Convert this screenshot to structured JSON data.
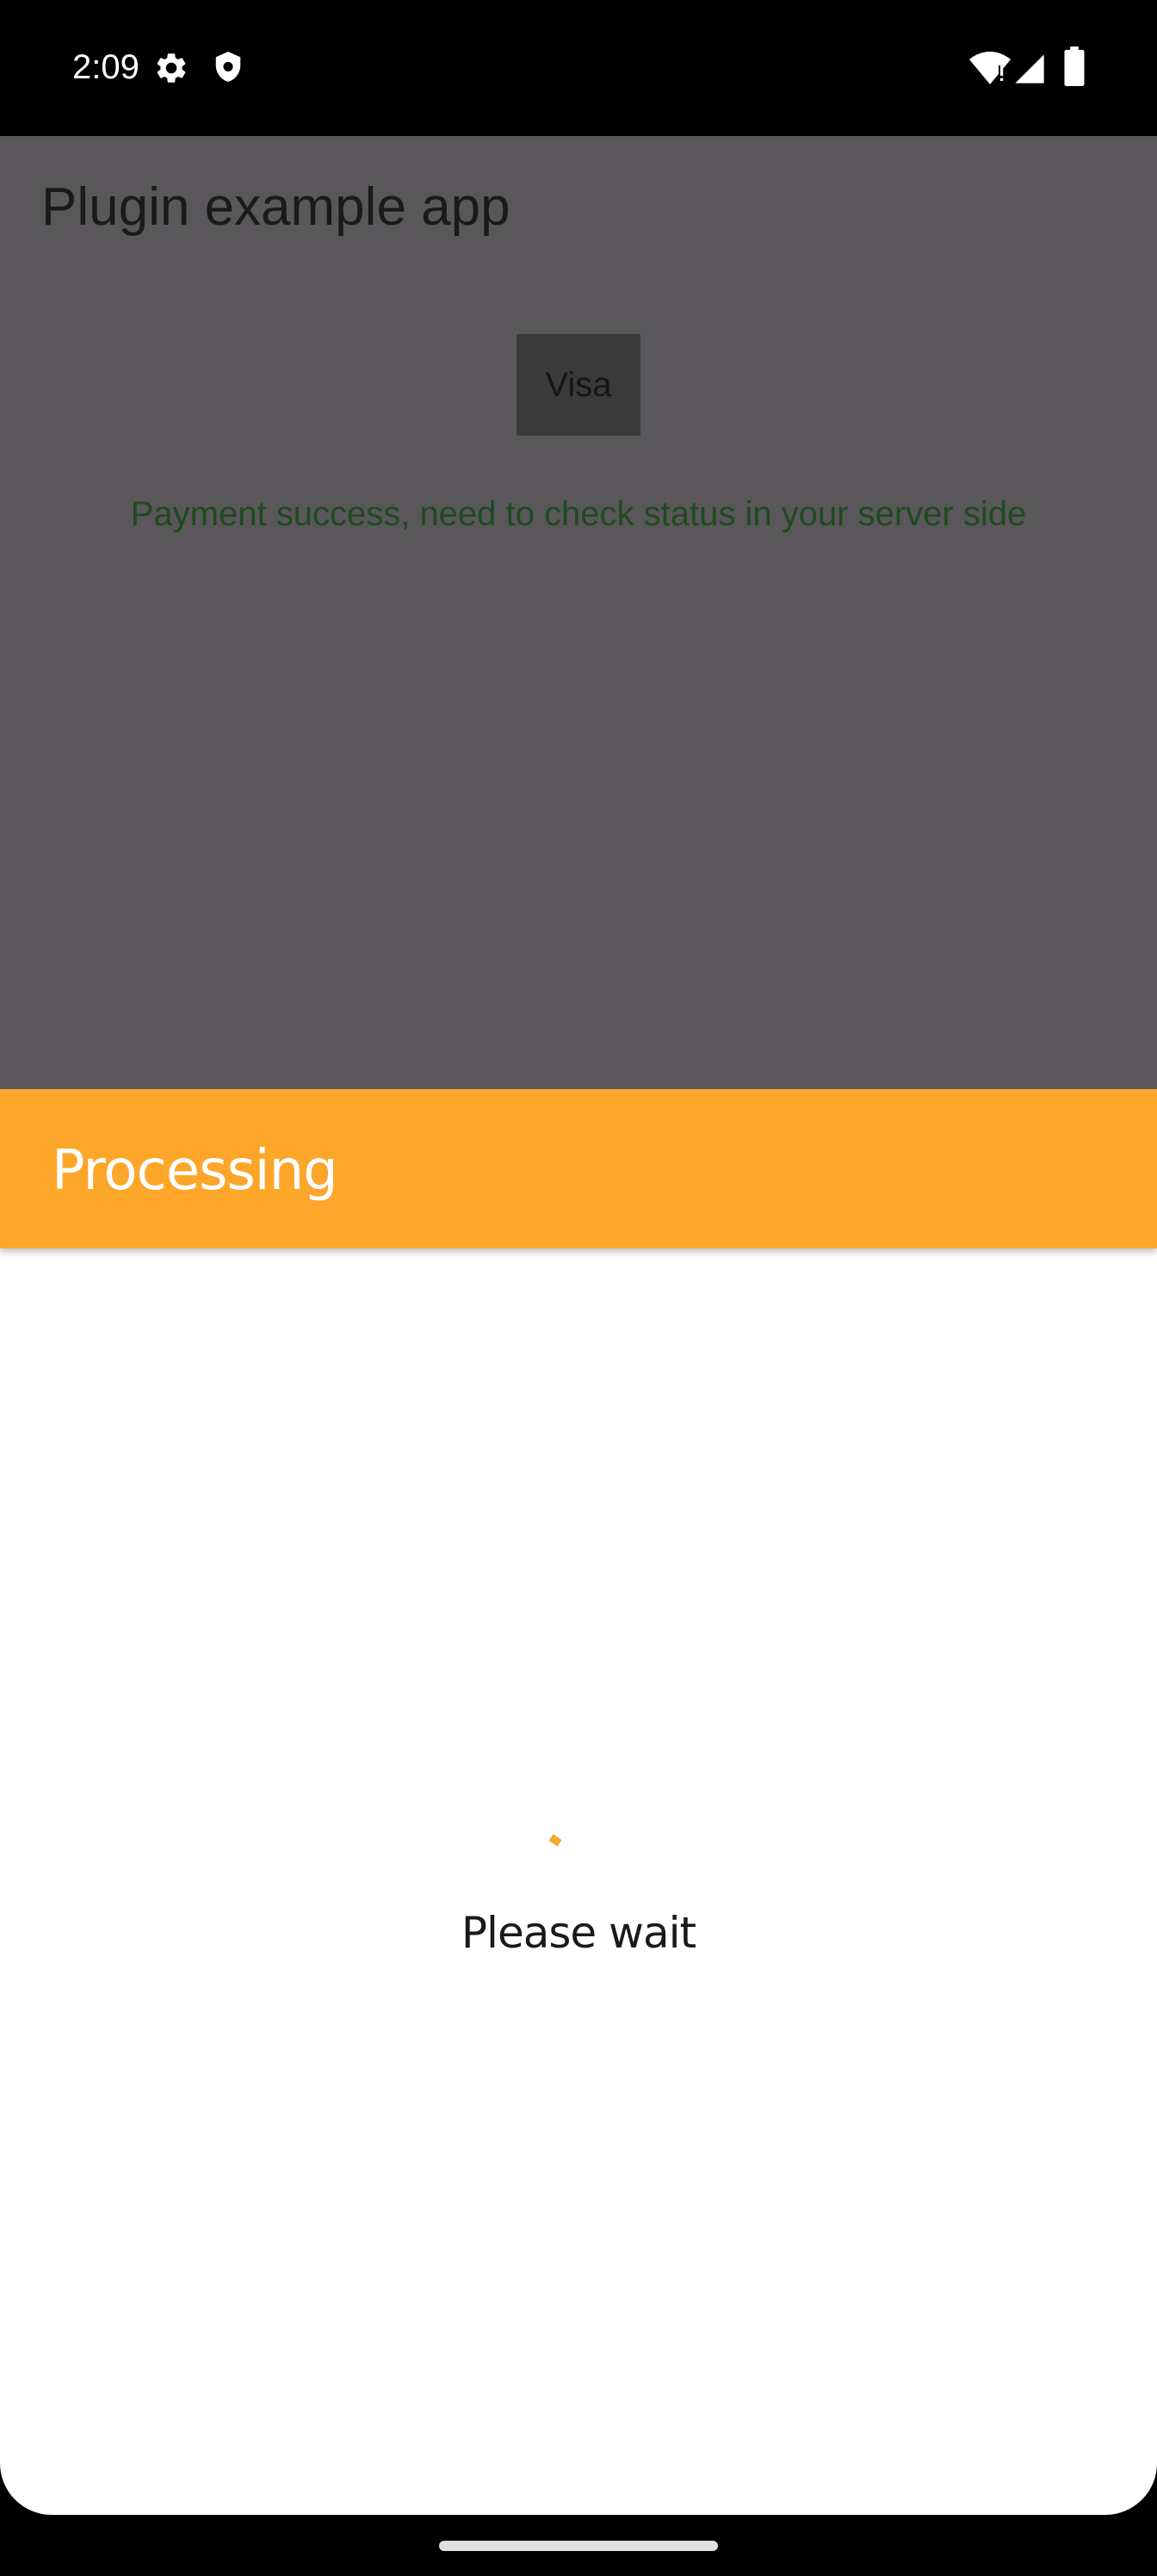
{
  "status_bar": {
    "time": "2:09",
    "icons": [
      "settings-gear-icon",
      "shield-icon",
      "wifi-icon",
      "cell-signal-icon",
      "battery-icon"
    ]
  },
  "app": {
    "title": "Plugin example app",
    "visa_button_label": "Visa",
    "status_message": "Payment success, need to check status in your server side",
    "status_message_color": "#1f4a1f"
  },
  "sheet": {
    "header_title": "Processing",
    "header_color": "#fda62a",
    "wait_text": "Please wait",
    "spinner_color": "#fda62a"
  }
}
